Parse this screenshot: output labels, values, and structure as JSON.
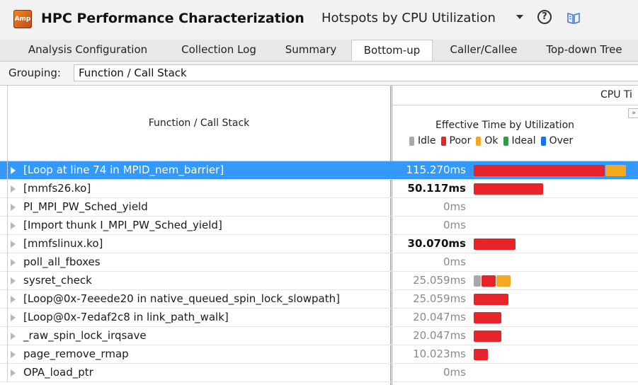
{
  "app": {
    "icon_text": "Amp",
    "title": "HPC Performance Characterization",
    "analysis_type": "Hotspots by CPU Utilization",
    "help_glyph": "?"
  },
  "tabs": [
    {
      "label": "Analysis Configuration",
      "active": false
    },
    {
      "label": "Collection Log",
      "active": false
    },
    {
      "label": "Summary",
      "active": false
    },
    {
      "label": "Bottom-up",
      "active": true
    },
    {
      "label": "Caller/Callee",
      "active": false
    },
    {
      "label": "Top-down Tree",
      "active": false
    }
  ],
  "grouping": {
    "label": "Grouping:",
    "value": "Function / Call Stack"
  },
  "grid": {
    "col_function": "Function / Call Stack",
    "col_cpu": "CPU Ti",
    "col_effective": "Effective Time by Utilization",
    "expand_glyph": "»",
    "legend": [
      {
        "label": "Idle",
        "color": "#a9a9a9"
      },
      {
        "label": "Poor",
        "color": "#e8232a"
      },
      {
        "label": "Ok",
        "color": "#f7a823"
      },
      {
        "label": "Ideal",
        "color": "#1ea734"
      },
      {
        "label": "Over",
        "color": "#1473e6"
      }
    ],
    "rows": [
      {
        "name": "[Loop at line 74 in MPID_nem_barrier]",
        "time": "115.270ms",
        "style": "selected",
        "segments": [
          {
            "type": "Poor",
            "ms": 95
          },
          {
            "type": "Ok",
            "ms": 15
          }
        ]
      },
      {
        "name": "[mmfs26.ko]",
        "time": "50.117ms",
        "style": "bold",
        "segments": [
          {
            "type": "Poor",
            "ms": 50.1
          }
        ]
      },
      {
        "name": "PI_MPI_PW_Sched_yield",
        "time": "0ms",
        "style": "gray",
        "segments": []
      },
      {
        "name": "[Import thunk I_MPI_PW_Sched_yield]",
        "time": "0ms",
        "style": "gray",
        "segments": []
      },
      {
        "name": "[mmfslinux.ko]",
        "time": "30.070ms",
        "style": "bold",
        "segments": [
          {
            "type": "Poor",
            "ms": 30.1
          }
        ]
      },
      {
        "name": "poll_all_fboxes",
        "time": "0ms",
        "style": "gray",
        "segments": []
      },
      {
        "name": "sysret_check",
        "time": "25.059ms",
        "style": "gray",
        "segments": [
          {
            "type": "Idle",
            "ms": 5
          },
          {
            "type": "Poor",
            "ms": 10
          },
          {
            "type": "Ok",
            "ms": 10
          }
        ]
      },
      {
        "name": "[Loop@0x-7eeede20 in native_queued_spin_lock_slowpath]",
        "time": "25.059ms",
        "style": "gray",
        "segments": [
          {
            "type": "Poor",
            "ms": 25.1
          }
        ]
      },
      {
        "name": "[Loop@0x-7edaf2c8 in link_path_walk]",
        "time": "20.047ms",
        "style": "gray",
        "segments": [
          {
            "type": "Poor",
            "ms": 20
          }
        ]
      },
      {
        "name": "_raw_spin_lock_irqsave",
        "time": "20.047ms",
        "style": "gray",
        "segments": [
          {
            "type": "Poor",
            "ms": 20
          }
        ]
      },
      {
        "name": "page_remove_rmap",
        "time": "10.023ms",
        "style": "gray",
        "segments": [
          {
            "type": "Poor",
            "ms": 10
          }
        ]
      },
      {
        "name": "OPA_load_ptr",
        "time": "0ms",
        "style": "gray",
        "segments": []
      }
    ]
  }
}
